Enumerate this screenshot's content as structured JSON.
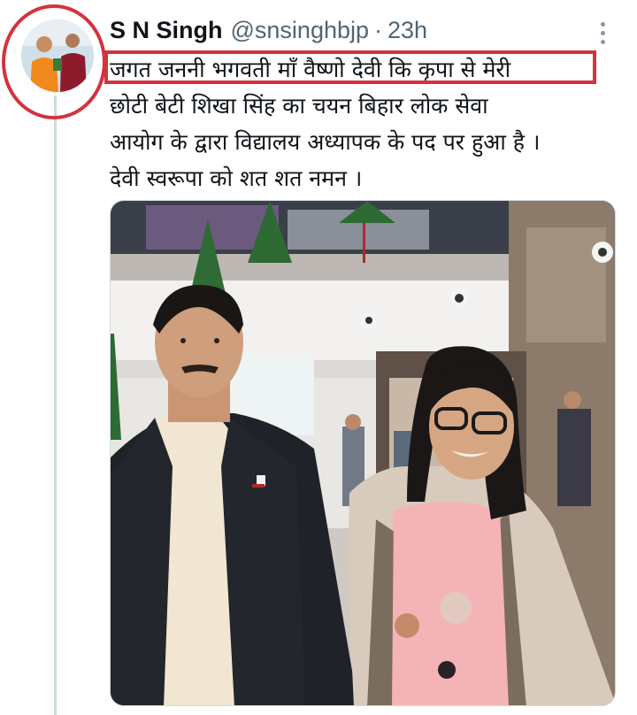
{
  "tweet": {
    "display_name": "S N Singh",
    "handle": "@snsinghbjp",
    "separator": "·",
    "time": "23h",
    "text_lines": [
      "जगत जननी भगवती माँ वैष्णो देवी कि कृपा से मेरी",
      "छोटी बेटी शिखा सिंह का चयन बिहार लोक सेवा",
      "आयोग के द्वारा विद्यालय अध्यापक के पद पर हुआ है ।",
      "देवी स्वरूपा को शत शत नमन ।"
    ]
  },
  "icons": {
    "more": "more-vertical-icon"
  },
  "colors": {
    "annotation": "#d4323e",
    "thread_line": "#cfd9de",
    "secondary_text": "#536471"
  }
}
